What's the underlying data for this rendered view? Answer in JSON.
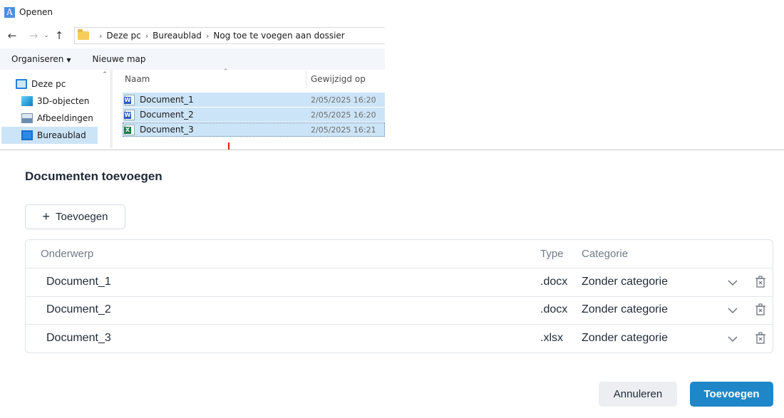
{
  "file_dialog": {
    "title": "Openen",
    "app_icon_glyph": "A",
    "breadcrumb": [
      "Deze pc",
      "Bureaublad",
      "Nog toe te voegen aan dossier"
    ],
    "commands": {
      "organize": "Organiseren",
      "new_folder": "Nieuwe map"
    },
    "nav_items": [
      {
        "label": "Deze pc",
        "icon": "computer-icon"
      },
      {
        "label": "3D-objecten",
        "icon": "cube-icon"
      },
      {
        "label": "Afbeeldingen",
        "icon": "pictures-icon"
      },
      {
        "label": "Bureaublad",
        "icon": "desktop-icon",
        "selected": true
      }
    ],
    "columns": {
      "name": "Naam",
      "modified": "Gewijzigd op"
    },
    "files": [
      {
        "name": "Document_1",
        "modified": "2/05/2025 16:20",
        "icon": "word-file-icon"
      },
      {
        "name": "Document_2",
        "modified": "2/05/2025 16:20",
        "icon": "word-file-icon"
      },
      {
        "name": "Document_3",
        "modified": "2/05/2025 16:21",
        "icon": "excel-file-icon"
      }
    ],
    "colors": {
      "selection": "#cce4f7"
    }
  },
  "annotation": {
    "arrow_color": "#e0201b"
  },
  "modal": {
    "title": "Documenten toevoegen",
    "add_button": "Toevoegen",
    "table": {
      "headers": {
        "subject": "Onderwerp",
        "type": "Type",
        "category": "Categorie"
      },
      "rows": [
        {
          "subject": "Document_1",
          "type": ".docx",
          "category": "Zonder categorie"
        },
        {
          "subject": "Document_2",
          "type": ".docx",
          "category": "Zonder categorie"
        },
        {
          "subject": "Document_3",
          "type": ".xlsx",
          "category": "Zonder categorie"
        }
      ]
    },
    "cancel_button": "Annuleren",
    "confirm_button": "Toevoegen",
    "colors": {
      "primary": "#1f87c8",
      "secondary": "#eceef1"
    }
  }
}
